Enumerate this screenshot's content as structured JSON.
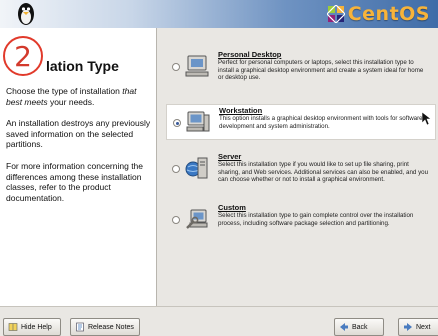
{
  "header": {
    "brand_text": "CentOS",
    "brand_color": "#f7b33a"
  },
  "step": {
    "number": "2",
    "color": "#d33a2c"
  },
  "help": {
    "title": "Installation Type",
    "title_visible": "lation Type",
    "paragraph1_prefix": "Choose the type of installation",
    "paragraph1_emphasis": "that best meets",
    "paragraph1_suffix": "your needs.",
    "paragraph2": "An installation destroys any previously saved information on the selected partitions.",
    "paragraph3": "For more information concerning the differences among these installation classes, refer to the product documentation."
  },
  "options": [
    {
      "title": "Personal Desktop",
      "description": "Perfect for personal computers or laptops, select this installation type to install a graphical desktop environment and create a system ideal for home or desktop use.",
      "selected": false,
      "icon": "desktop-computer-icon"
    },
    {
      "title": "Workstation",
      "description": "This option installs a graphical desktop environment with tools for software development and system administration.",
      "selected": true,
      "icon": "workstation-computer-icon"
    },
    {
      "title": "Server",
      "description": "Select this installation type if you would like to set up file sharing, print sharing, and Web services. Additional services can also be enabled, and you can choose whether or not to install a graphical environment.",
      "selected": false,
      "icon": "server-icon"
    },
    {
      "title": "Custom",
      "description": "Select this installation type to gain complete control over the installation process, including software package selection and partitioning.",
      "selected": false,
      "icon": "custom-wrench-icon"
    }
  ],
  "footer": {
    "hide_help_label": "Hide Help",
    "release_notes_label": "Release Notes",
    "back_label": "Back",
    "next_label": "Next"
  }
}
